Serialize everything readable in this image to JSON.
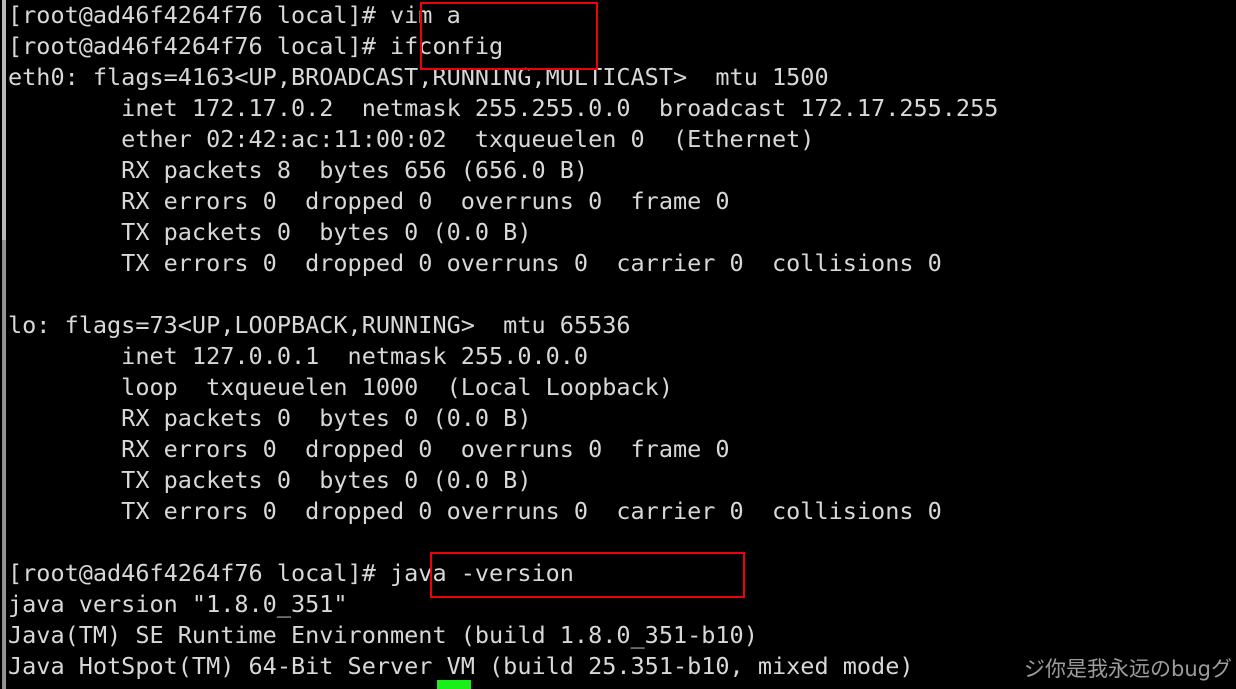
{
  "terminal": {
    "app": "linux-terminal",
    "background_color": "#000000",
    "foreground_color": "#d8d8d8",
    "cursor_color": "#19f019",
    "highlight_color": "#f0000c",
    "prompt": "[root@ad46f4264f76 local]#",
    "hostname": "ad46f4264f76",
    "user": "root",
    "cwd": "local",
    "lines": [
      "[root@ad46f4264f76 local]# vim a",
      "[root@ad46f4264f76 local]# ifconfig",
      "eth0: flags=4163<UP,BROADCAST,RUNNING,MULTICAST>  mtu 1500",
      "        inet 172.17.0.2  netmask 255.255.0.0  broadcast 172.17.255.255",
      "        ether 02:42:ac:11:00:02  txqueuelen 0  (Ethernet)",
      "        RX packets 8  bytes 656 (656.0 B)",
      "        RX errors 0  dropped 0  overruns 0  frame 0",
      "        TX packets 0  bytes 0 (0.0 B)",
      "        TX errors 0  dropped 0 overruns 0  carrier 0  collisions 0",
      "",
      "lo: flags=73<UP,LOOPBACK,RUNNING>  mtu 65536",
      "        inet 127.0.0.1  netmask 255.0.0.0",
      "        loop  txqueuelen 1000  (Local Loopback)",
      "        RX packets 0  bytes 0 (0.0 B)",
      "        RX errors 0  dropped 0  overruns 0  frame 0",
      "        TX packets 0  bytes 0 (0.0 B)",
      "        TX errors 0  dropped 0 overruns 0  carrier 0  collisions 0",
      "",
      "[root@ad46f4264f76 local]# java -version",
      "java version \"1.8.0_351\"",
      "Java(TM) SE Runtime Environment (build 1.8.0_351-b10)",
      "Java HotSpot(TM) 64-Bit Server VM (build 25.351-b10, mixed mode)"
    ],
    "annotations": [
      {
        "name": "vim-ifconfig-highlight",
        "commands": [
          "vim a",
          "ifconfig"
        ],
        "color": "#f0000c"
      },
      {
        "name": "java-version-highlight",
        "commands": [
          "java -version"
        ],
        "color": "#f0000c"
      }
    ],
    "interfaces": [
      {
        "name": "eth0",
        "flags": "4163<UP,BROADCAST,RUNNING,MULTICAST>",
        "mtu": "1500",
        "inet": "172.17.0.2",
        "netmask": "255.255.0.0",
        "broadcast": "172.17.255.255",
        "ether": "02:42:ac:11:00:02",
        "txqueuelen": "0",
        "type": "Ethernet",
        "rx_packets": "8",
        "rx_bytes": "656 (656.0 B)",
        "rx_errors": "0",
        "rx_dropped": "0",
        "rx_overruns": "0",
        "rx_frame": "0",
        "tx_packets": "0",
        "tx_bytes": "0 (0.0 B)",
        "tx_errors": "0",
        "tx_dropped": "0",
        "tx_overruns": "0",
        "tx_carrier": "0",
        "tx_collisions": "0"
      },
      {
        "name": "lo",
        "flags": "73<UP,LOOPBACK,RUNNING>",
        "mtu": "65536",
        "inet": "127.0.0.1",
        "netmask": "255.0.0.0",
        "txqueuelen": "1000",
        "type": "Local Loopback",
        "rx_packets": "0",
        "rx_bytes": "0 (0.0 B)",
        "rx_errors": "0",
        "rx_dropped": "0",
        "rx_overruns": "0",
        "rx_frame": "0",
        "tx_packets": "0",
        "tx_bytes": "0 (0.0 B)",
        "tx_errors": "0",
        "tx_dropped": "0",
        "tx_overruns": "0",
        "tx_carrier": "0",
        "tx_collisions": "0"
      }
    ],
    "java": {
      "version": "1.8.0_351",
      "runtime": "Java(TM) SE Runtime Environment (build 1.8.0_351-b10)",
      "vm": "Java HotSpot(TM) 64-Bit Server VM (build 25.351-b10, mixed mode)"
    },
    "cursor": {
      "visible": true,
      "shape": "block"
    }
  },
  "watermark": {
    "text": "ジ你是我永远のbugグ"
  }
}
